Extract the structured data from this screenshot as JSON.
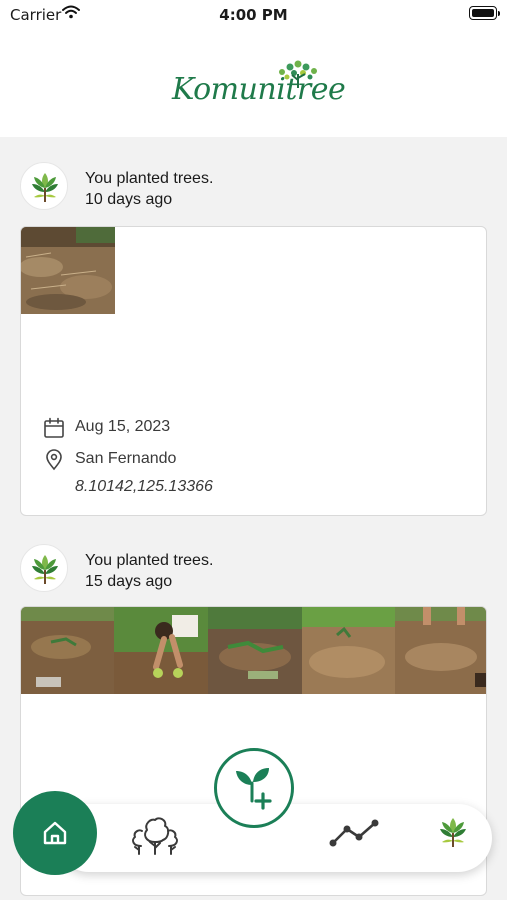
{
  "status_bar": {
    "carrier": "Carrier",
    "time": "4:00 PM"
  },
  "header": {
    "brand": "Komunitree"
  },
  "feed": {
    "posts": [
      {
        "message": "You planted trees.",
        "time_ago": "10 days ago",
        "photo_count": 1,
        "date": "Aug 15, 2023",
        "location": "San Fernando",
        "coordinates": "8.10142,125.13366"
      },
      {
        "message": "You planted trees.",
        "time_ago": "15 days ago",
        "photo_count": 5
      }
    ]
  },
  "nav": {
    "items": [
      "home-icon",
      "trees-icon",
      "add-plant-icon",
      "stats-icon",
      "profile-icon"
    ],
    "active": "home",
    "accent": "#1b7f57"
  }
}
